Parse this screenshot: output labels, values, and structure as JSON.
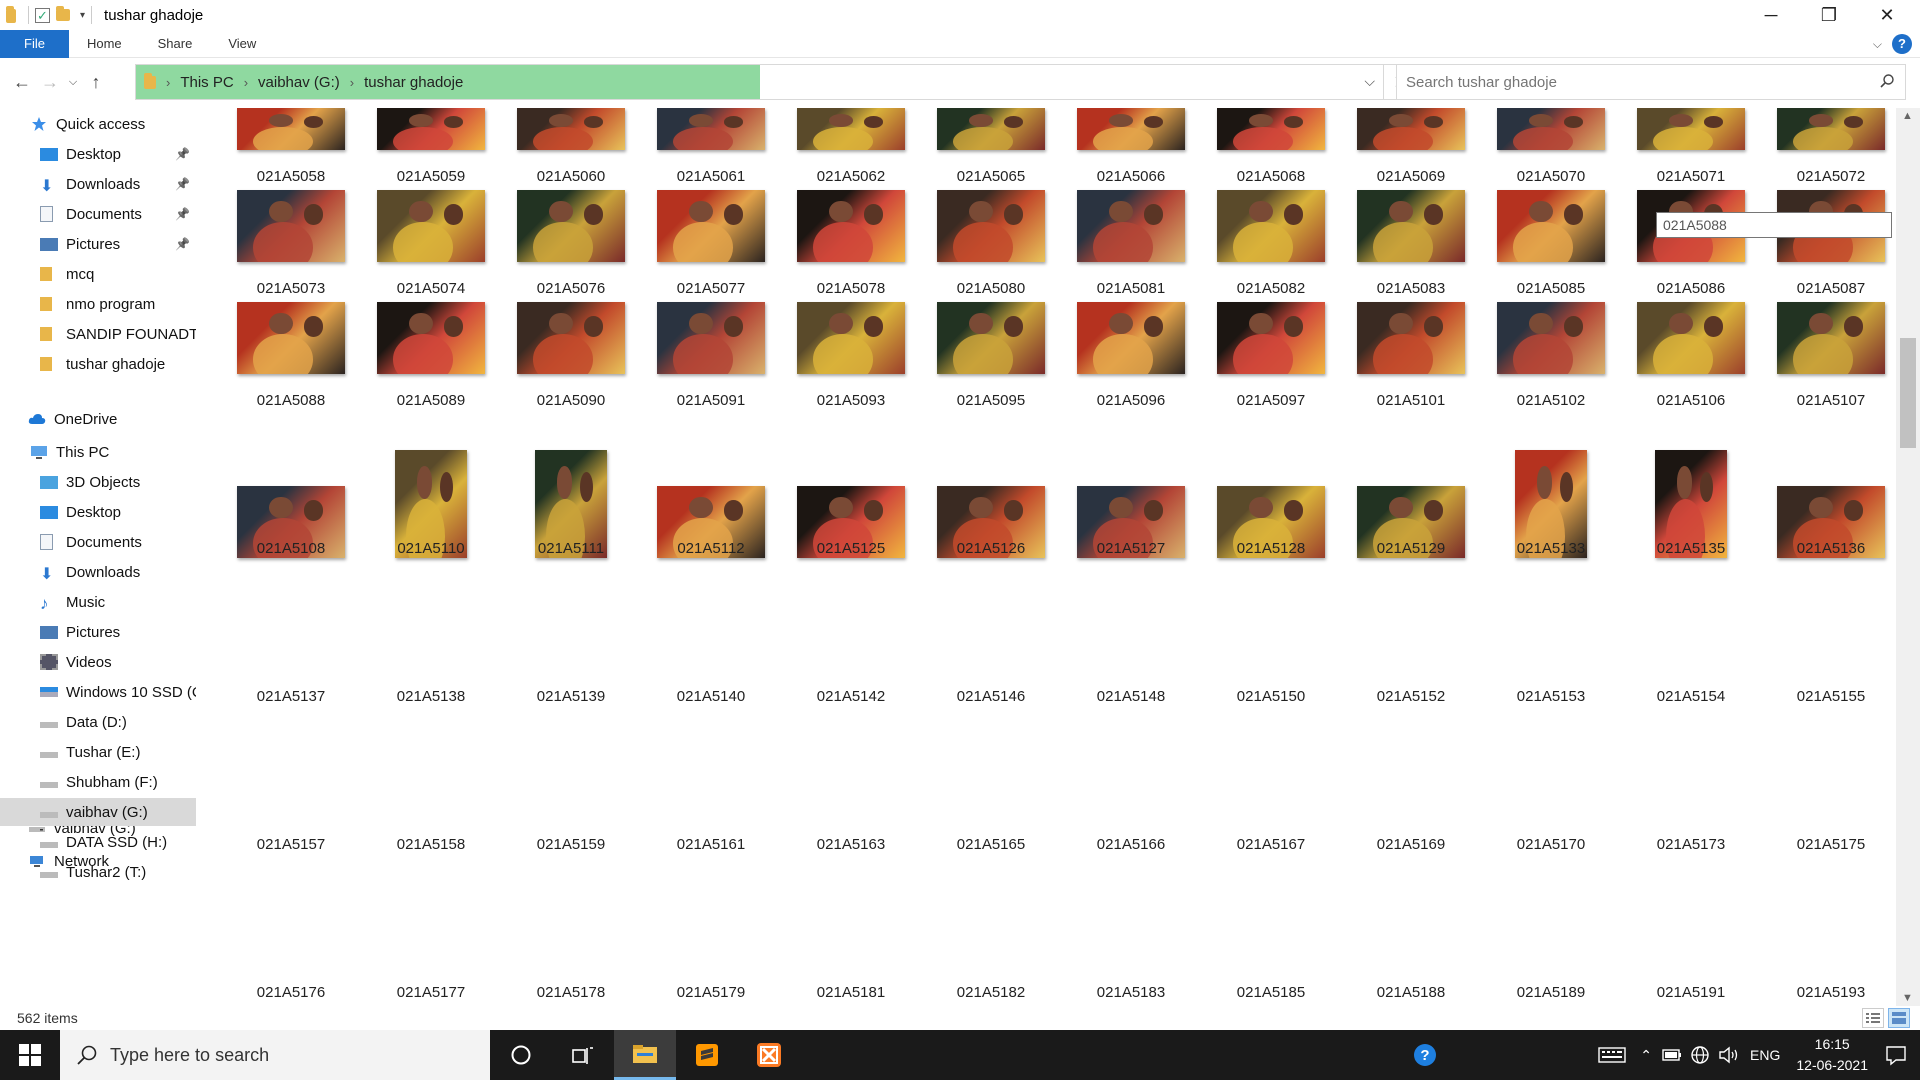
{
  "window": {
    "title": "tushar ghadoje"
  },
  "ribbon": {
    "tabs": [
      "File",
      "Home",
      "Share",
      "View"
    ]
  },
  "address": {
    "crumbs": [
      "This PC",
      "vaibhav  (G:)",
      "tushar ghadoje"
    ]
  },
  "search": {
    "placeholder": "Search tushar ghadoje"
  },
  "sidebar": {
    "quick_access": "Quick access",
    "quick_items": [
      "Desktop",
      "Downloads",
      "Documents",
      "Pictures",
      "mcq",
      "nmo program",
      "SANDIP FOUNADTIO",
      "tushar ghadoje"
    ],
    "onedrive": "OneDrive",
    "this_pc": "This PC",
    "pc_items": [
      "3D Objects",
      "Desktop",
      "Documents",
      "Downloads",
      "Music",
      "Pictures",
      "Videos",
      "Windows 10 SSD (C",
      "Data (D:)",
      "Tushar (E:)",
      "Shubham (F:)",
      "vaibhav  (G:)",
      "DATA SSD (H:)",
      "Tushar2 (T:)"
    ],
    "drive": "vaibhav  (G:)",
    "network": "Network"
  },
  "files": {
    "rows": [
      [
        "021A5058",
        "021A5059",
        "021A5060",
        "021A5061",
        "021A5062",
        "021A5065",
        "021A5066",
        "021A5068",
        "021A5069",
        "021A5070",
        "021A5071",
        "021A5072"
      ],
      [
        "021A5073",
        "021A5074",
        "021A5076",
        "021A5077",
        "021A5078",
        "021A5080",
        "021A5081",
        "021A5082",
        "021A5083",
        "021A5085",
        "021A5086",
        "021A5087"
      ],
      [
        "021A5088",
        "021A5089",
        "021A5090",
        "021A5091",
        "021A5093",
        "021A5095",
        "021A5096",
        "021A5097",
        "021A5101",
        "021A5102",
        "021A5106",
        "021A5107"
      ],
      [
        "021A5108",
        "021A5110",
        "021A5111",
        "021A5112",
        "021A5125",
        "021A5126",
        "021A5127",
        "021A5128",
        "021A5129",
        "021A5133",
        "021A5135",
        "021A5136"
      ],
      [
        "021A5137",
        "021A5138",
        "021A5139",
        "021A5140",
        "021A5142",
        "021A5146",
        "021A5148",
        "021A5150",
        "021A5152",
        "021A5153",
        "021A5154",
        "021A5155"
      ],
      [
        "021A5157",
        "021A5158",
        "021A5159",
        "021A5161",
        "021A5163",
        "021A5165",
        "021A5166",
        "021A5167",
        "021A5169",
        "021A5170",
        "021A5173",
        "021A5175"
      ],
      [
        "021A5176",
        "021A5177",
        "021A5178",
        "021A5179",
        "021A5181",
        "021A5182",
        "021A5183",
        "021A5185",
        "021A5188",
        "021A5189",
        "021A5191",
        "021A5193"
      ]
    ],
    "tooltip": "021A5088"
  },
  "status": {
    "item_count": "562 items"
  },
  "taskbar": {
    "search_placeholder": "Type here to search",
    "language": "ENG",
    "time": "16:15",
    "date": "12-06-2021"
  }
}
